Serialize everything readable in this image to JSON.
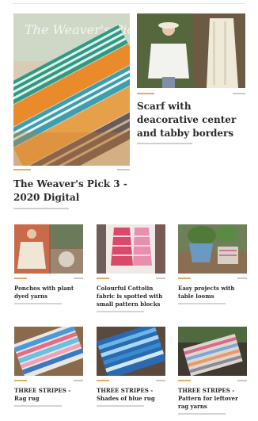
{
  "featured_main": {
    "title": "The Weaver's Pick 3 - 2020 Digital",
    "image_icon": "woven-fabric-magazine-cover"
  },
  "featured_side": {
    "title": "Scarf with deacorative center and tabby borders",
    "image_icon": "woman-in-poncho-photo"
  },
  "cards": [
    {
      "title": "Ponchos with plant dyed yarns",
      "image_icon": "poncho-photo"
    },
    {
      "title": "Colourful Cottolin fabric is spotted with small pattern blocks",
      "image_icon": "pink-fabric-photo"
    },
    {
      "title": "Easy projects with table looms",
      "image_icon": "potted-plant-photo"
    },
    {
      "title": "THREE STRIPES - Rag rug",
      "image_icon": "rag-rug-photo"
    },
    {
      "title": "THREE STRIPES - Shades of blue rug",
      "image_icon": "blue-rug-photo"
    },
    {
      "title": "THREE STRIPES - Pattern for leftover rag yarns",
      "image_icon": "leftover-rug-photo"
    }
  ],
  "colors": {
    "tag": "#e0b060",
    "title": "#2a2a2a"
  }
}
